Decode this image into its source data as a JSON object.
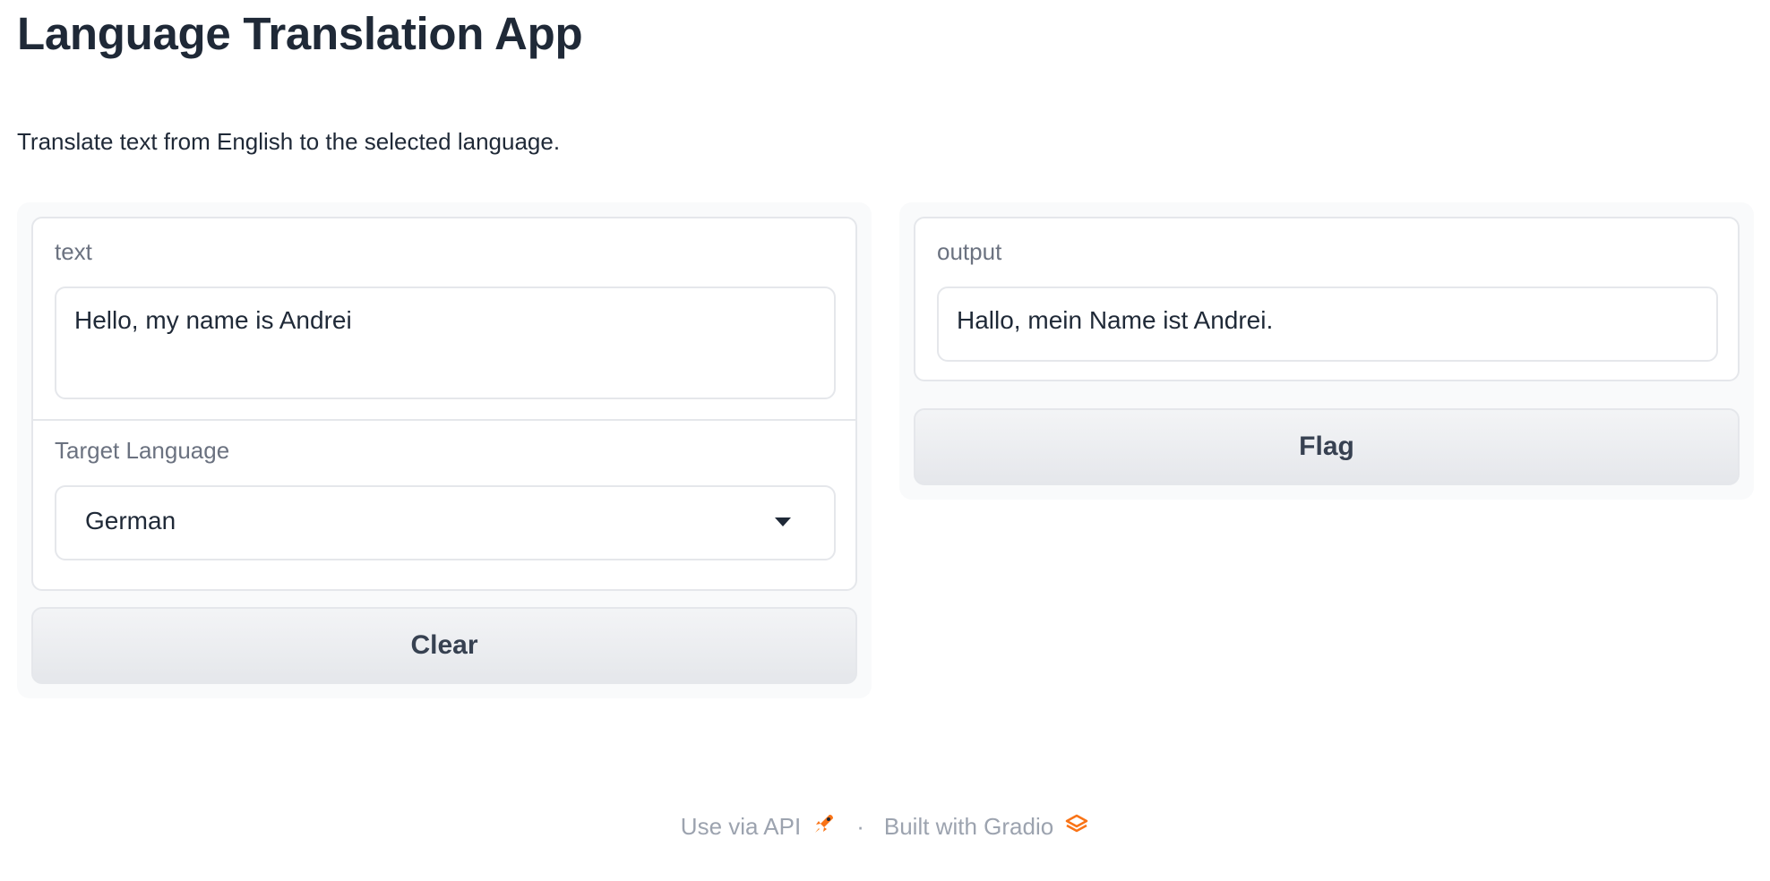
{
  "app": {
    "title": "Language Translation App",
    "description": "Translate text from English to the selected language."
  },
  "inputs": {
    "text": {
      "label": "text",
      "value": "Hello, my name is Andrei"
    },
    "target_language": {
      "label": "Target Language",
      "selected": "German"
    },
    "clear_label": "Clear"
  },
  "outputs": {
    "output": {
      "label": "output",
      "value": "Hallo, mein Name ist Andrei."
    },
    "flag_label": "Flag"
  },
  "footer": {
    "api_label": "Use via API",
    "separator": "·",
    "built_label": "Built with Gradio",
    "api_icon": "rocket-icon",
    "gradio_icon": "gradio-logo-icon",
    "accent_color": "#f97316"
  }
}
